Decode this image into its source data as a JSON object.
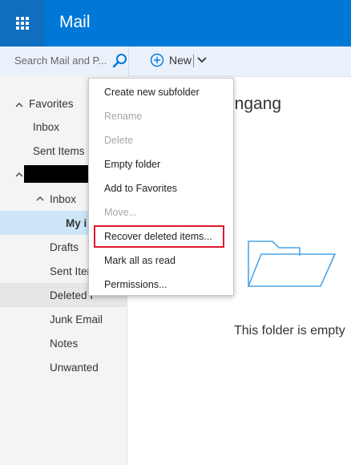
{
  "header": {
    "app_title": "Mail"
  },
  "search": {
    "placeholder": "Search Mail and P..."
  },
  "toolbar": {
    "new_label": "New"
  },
  "sidebar": {
    "favorites_label": "Favorites",
    "favorites": [
      "Inbox",
      "Sent Items"
    ],
    "folders": [
      "Inbox",
      "My i",
      "Drafts",
      "Sent Iter",
      "Deleted I",
      "Junk Email",
      "Notes",
      "Unwanted"
    ]
  },
  "main": {
    "folder_title": "ingang",
    "empty_message": "This folder is empty"
  },
  "context_menu": {
    "items": [
      {
        "label": "Create new subfolder",
        "enabled": true
      },
      {
        "label": "Rename",
        "enabled": false
      },
      {
        "label": "Delete",
        "enabled": false
      },
      {
        "label": "Empty folder",
        "enabled": true
      },
      {
        "label": "Add to Favorites",
        "enabled": true
      },
      {
        "label": "Move...",
        "enabled": false
      },
      {
        "label": "Recover deleted items...",
        "enabled": true,
        "highlighted": true
      },
      {
        "label": "Mark all as read",
        "enabled": true
      },
      {
        "label": "Permissions...",
        "enabled": true
      }
    ]
  },
  "colors": {
    "brand": "#0078d7",
    "selection": "#cde6f7",
    "highlight_border": "#e0192d"
  },
  "icons": {
    "app_launcher": "waffle-icon",
    "search": "search-icon",
    "new": "plus-circle-icon",
    "new_dropdown": "chevron-down-icon",
    "empty_folder": "folder-icon"
  }
}
